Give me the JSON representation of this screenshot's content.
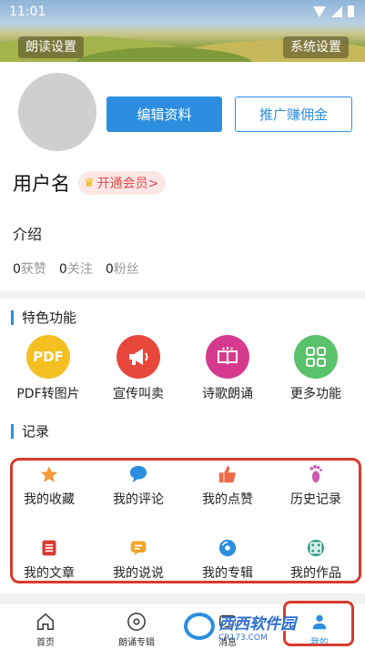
{
  "status_bar": {
    "time": "11:01"
  },
  "header": {
    "read_settings": "朗读设置",
    "system_settings": "系统设置"
  },
  "profile": {
    "edit_button": "编辑资料",
    "promo_button": "推广赚佣金",
    "username": "用户名",
    "vip_badge": "开通会员>",
    "intro_label": "介绍",
    "stats": [
      {
        "count": "0",
        "label": "获赞"
      },
      {
        "count": "0",
        "label": "关注"
      },
      {
        "count": "0",
        "label": "粉丝"
      }
    ]
  },
  "features": {
    "title": "特色功能",
    "items": [
      {
        "label": "PDF转图片",
        "icon": "pdf-icon",
        "icon_text": "PDF",
        "color": "#f4c021"
      },
      {
        "label": "宣传叫卖",
        "icon": "megaphone-icon",
        "color": "#e8473c"
      },
      {
        "label": "诗歌朗诵",
        "icon": "book-icon",
        "color": "#d53a8f"
      },
      {
        "label": "更多功能",
        "icon": "grid-icon",
        "color": "#5ac26a"
      }
    ]
  },
  "records": {
    "title": "记录",
    "items": [
      {
        "label": "我的收藏",
        "icon": "star-icon",
        "color": "#f39c3a"
      },
      {
        "label": "我的评论",
        "icon": "comment-icon",
        "color": "#2d8ee0"
      },
      {
        "label": "我的点赞",
        "icon": "thumbs-up-icon",
        "color": "#ef6a4a"
      },
      {
        "label": "历史记录",
        "icon": "footprint-icon",
        "color": "#c85ab0"
      },
      {
        "label": "我的文章",
        "icon": "article-icon",
        "color": "#d93a2f"
      },
      {
        "label": "我的说说",
        "icon": "chat-icon",
        "color": "#f2a52a"
      },
      {
        "label": "我的专辑",
        "icon": "disc-icon",
        "color": "#2d8ee0"
      },
      {
        "label": "我的作品",
        "icon": "works-icon",
        "color": "#3aa38a"
      }
    ]
  },
  "navbar": {
    "items": [
      {
        "label": "首页",
        "icon": "home-icon"
      },
      {
        "label": "朗诵专辑",
        "icon": "disc-icon"
      },
      {
        "label": "消息",
        "icon": "message-icon"
      },
      {
        "label": "我的",
        "icon": "user-icon",
        "active": true
      }
    ]
  },
  "watermark": {
    "text": "西西软件园",
    "sub": "CR173.COM"
  }
}
